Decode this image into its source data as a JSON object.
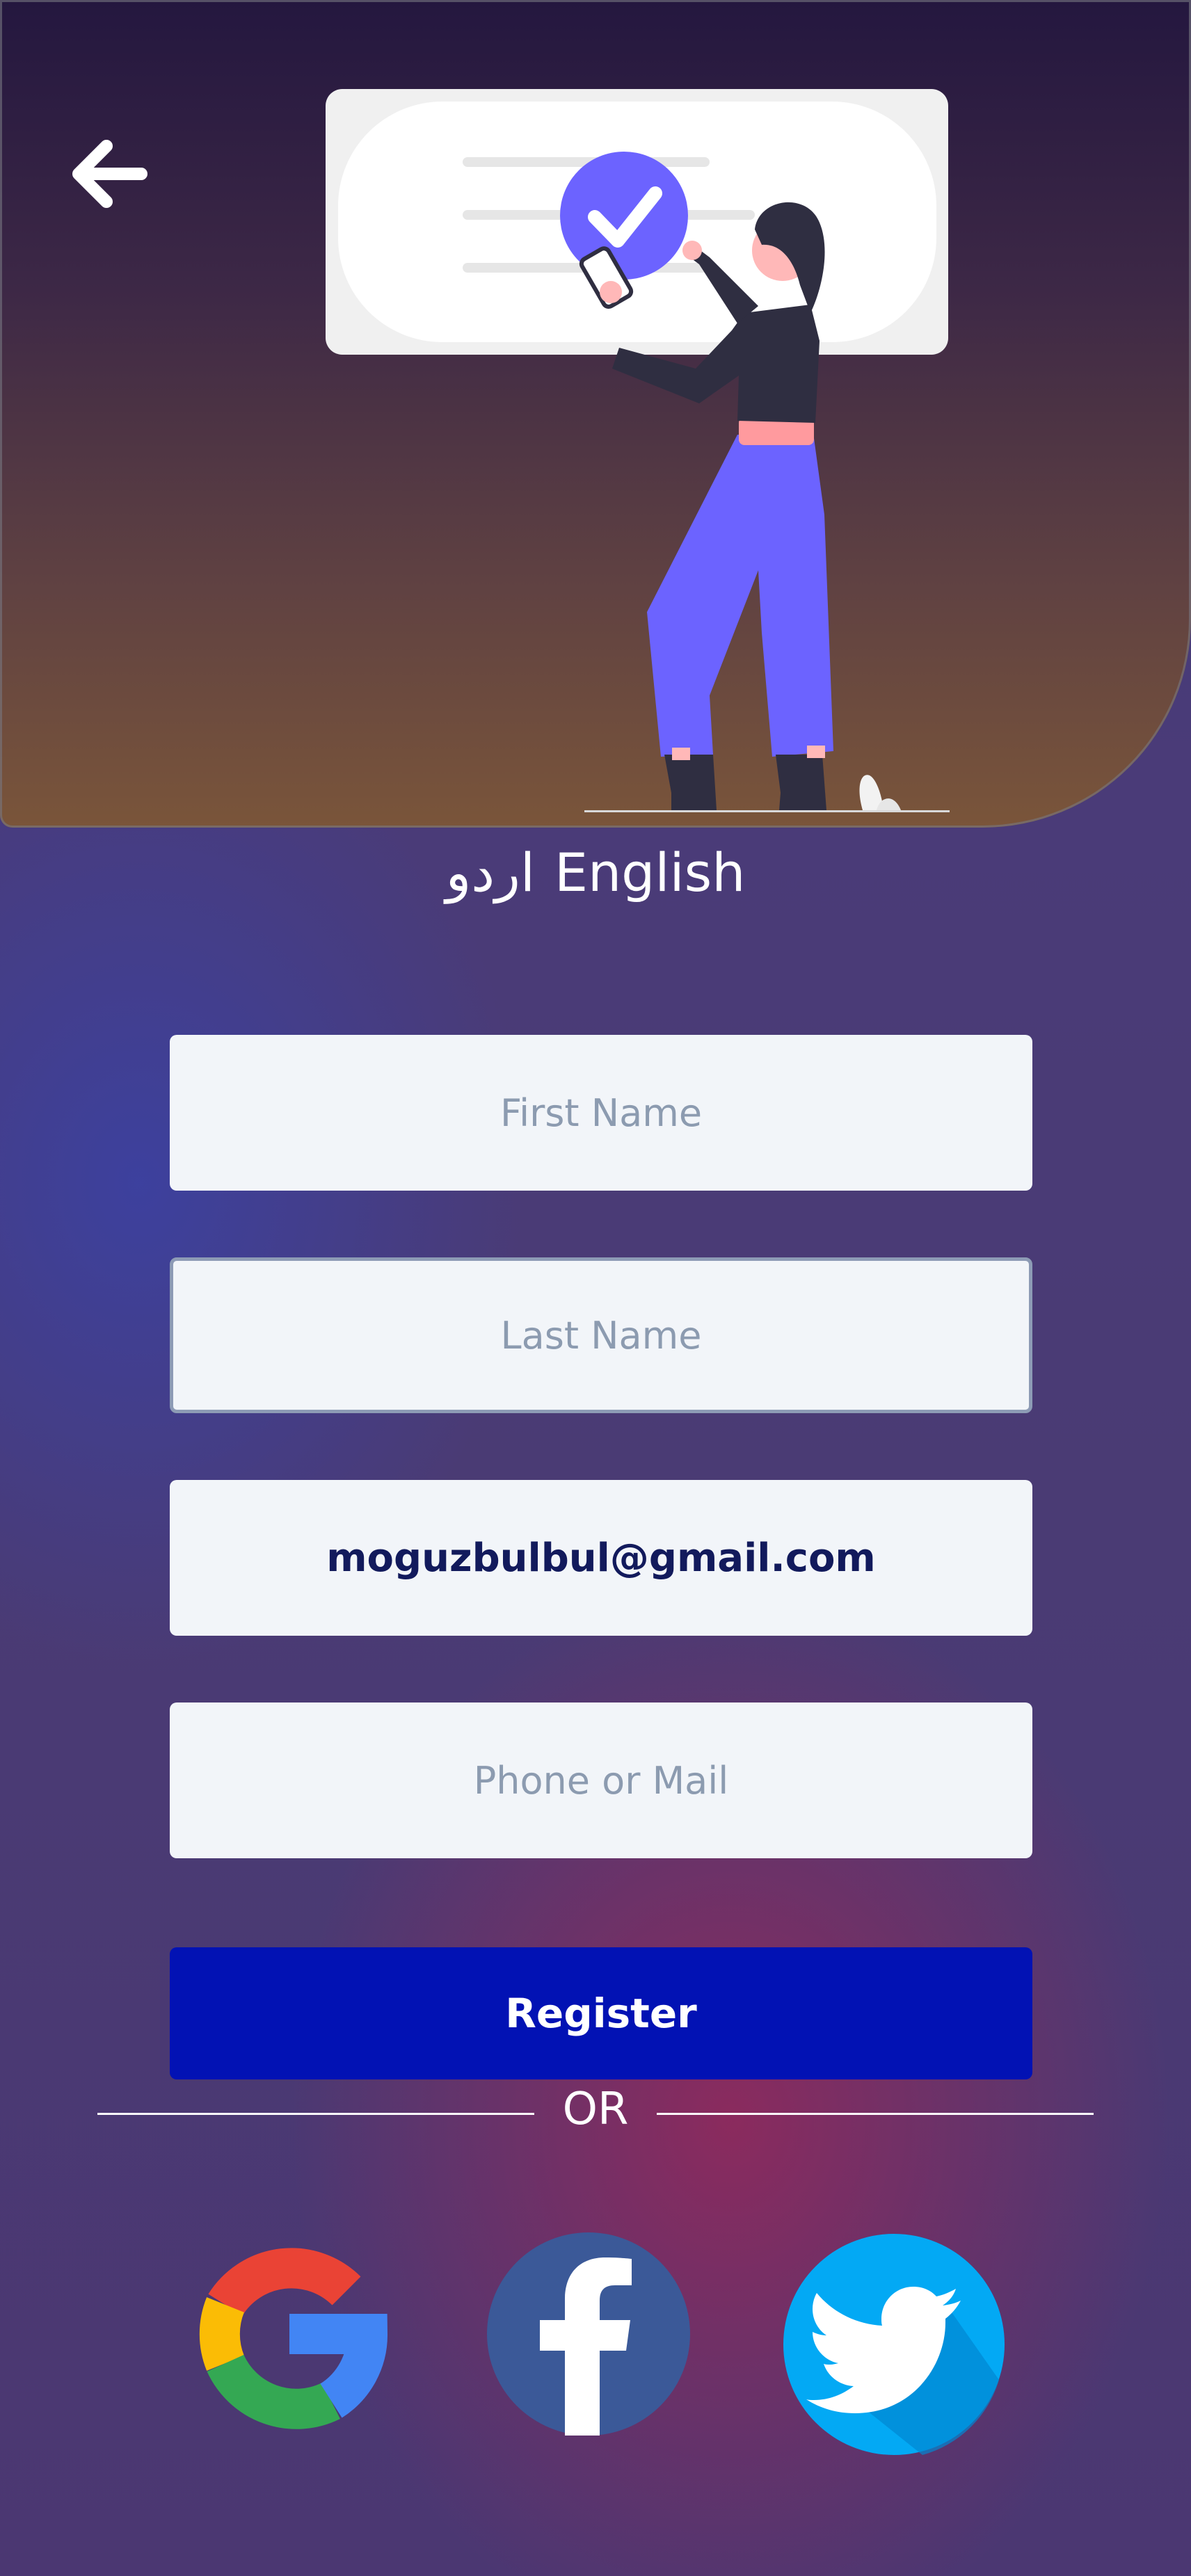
{
  "header": {
    "back_icon": "arrow-left-icon",
    "illustration": "woman-checkmark-illustration"
  },
  "language": {
    "urdu": "اردو",
    "english": "English"
  },
  "form": {
    "first_name_placeholder": "First Name",
    "last_name_placeholder": "Last Name",
    "email_value": "moguzbulbul@gmail.com",
    "phone_placeholder": "Phone or Mail",
    "register_label": "Register",
    "or_label": "OR"
  },
  "social": {
    "google_icon": "google-icon",
    "facebook_icon": "facebook-icon",
    "twitter_icon": "twitter-icon"
  },
  "colors": {
    "register_button": "#0212b4",
    "field_background": "#f2f5f9",
    "placeholder_text": "#8c9bb0",
    "value_text": "#121a5c",
    "facebook": "#3b5998",
    "twitter": "#03a9f4",
    "illustration_accent": "#6c63ff"
  }
}
